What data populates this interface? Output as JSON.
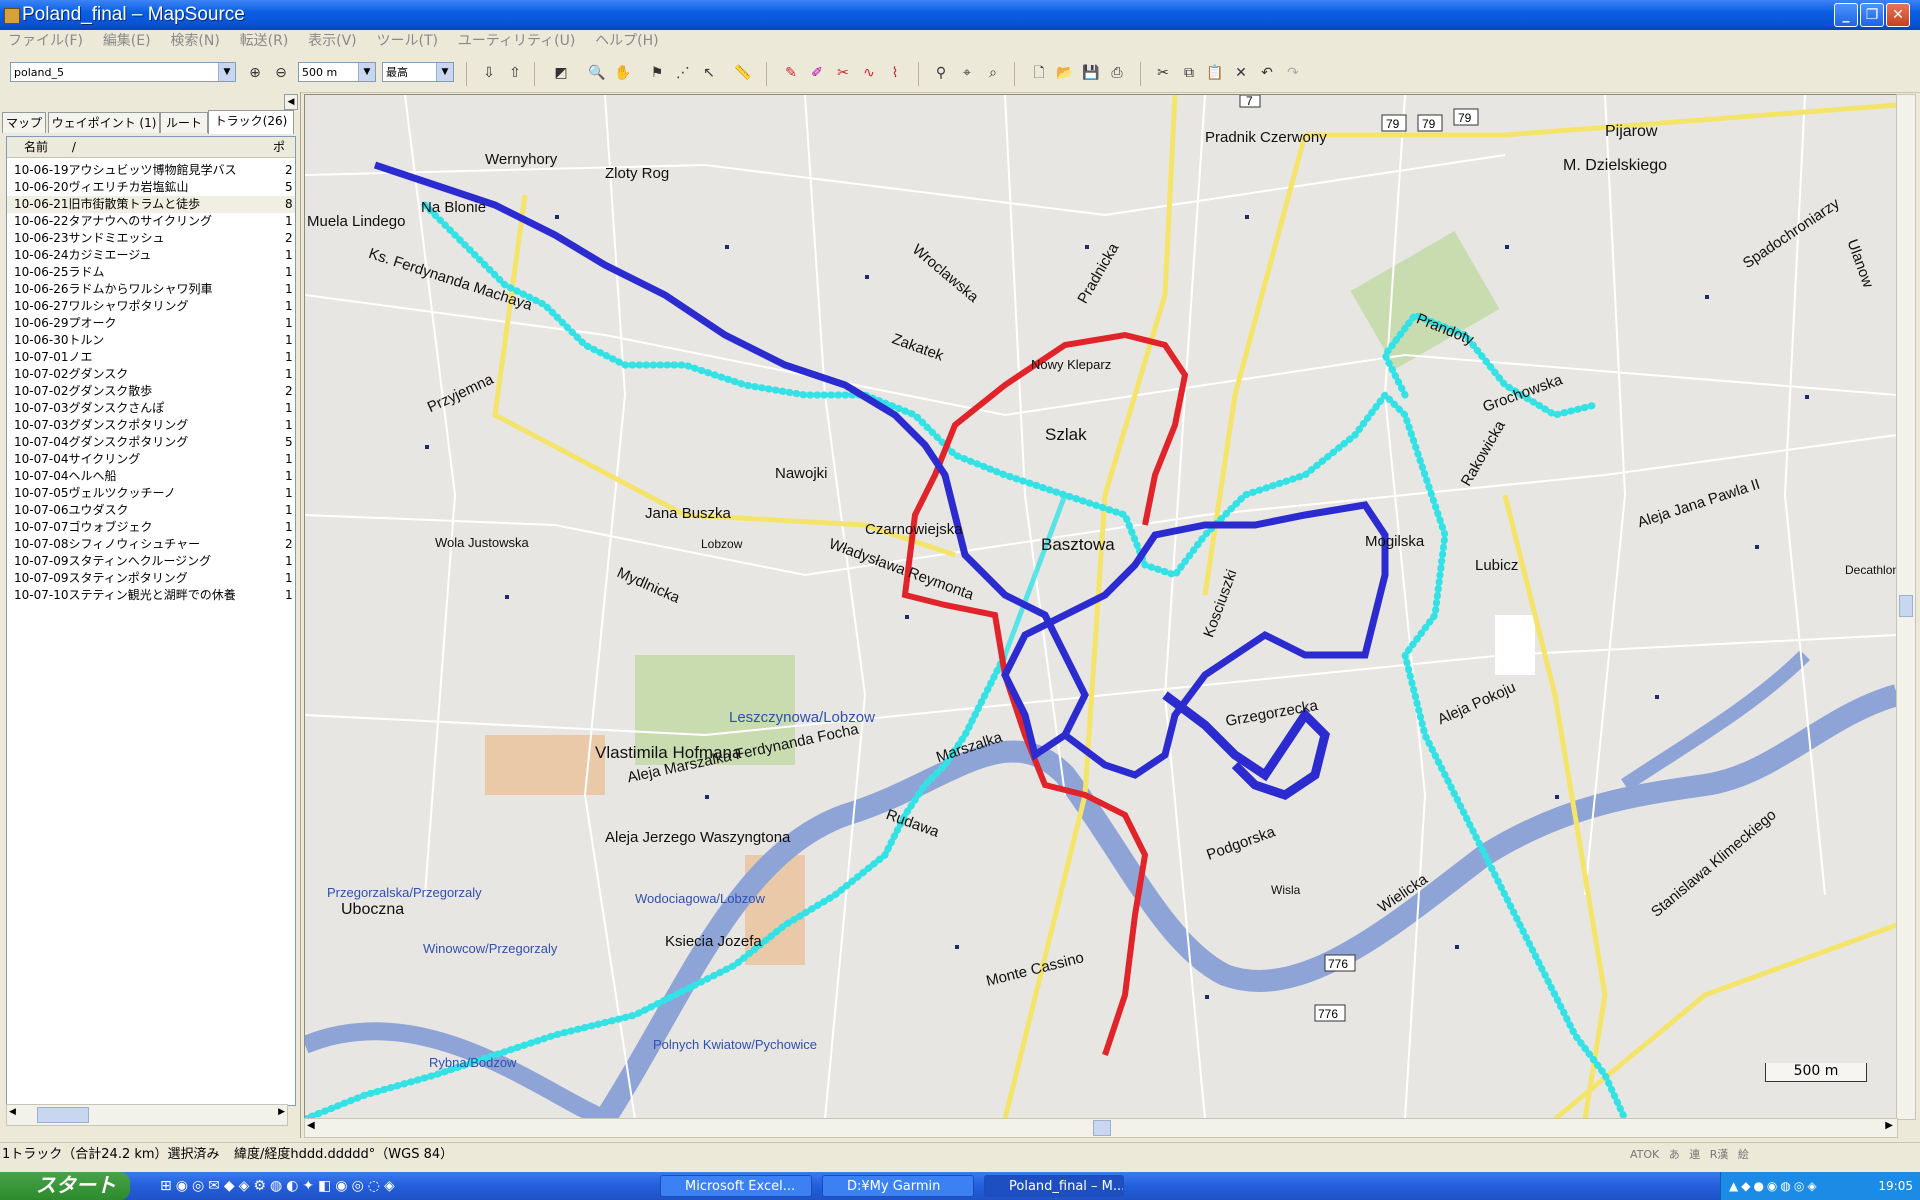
{
  "window": {
    "title": "Poland_final – MapSource",
    "min": "_",
    "max": "❐",
    "close": "✕"
  },
  "menu": [
    "ファイル(F)",
    "編集(E)",
    "検索(N)",
    "転送(R)",
    "表示(V)",
    "ツール(T)",
    "ユーティリティ(U)",
    "ヘルプ(H)"
  ],
  "toolbar": {
    "product": "poland_5",
    "scale": "500 m",
    "detail": "最高"
  },
  "tabs": [
    "マップ",
    "ウェイポイント (1)",
    "ルート",
    "トラック(26)"
  ],
  "list": {
    "col_name": "名前",
    "col_sort": "/",
    "col_pts": "ポ",
    "rows": [
      {
        "name": "10-06-19アウシュビッツ博物館見学バス",
        "v": "2"
      },
      {
        "name": "10-06-20ヴィエリチカ岩塩鉱山",
        "v": "5"
      },
      {
        "name": "10-06-21旧市街散策トラムと徒歩",
        "v": "8"
      },
      {
        "name": "10-06-22タアナウへのサイクリング",
        "v": "1"
      },
      {
        "name": "10-06-23サンドミエッシュ",
        "v": "2"
      },
      {
        "name": "10-06-24カジミエージュ",
        "v": "1"
      },
      {
        "name": "10-06-25ラドム",
        "v": "1"
      },
      {
        "name": "10-06-26ラドムからワルシャワ列車",
        "v": "1"
      },
      {
        "name": "10-06-27ワルシャワポタリング",
        "v": "1"
      },
      {
        "name": "10-06-29プオーク",
        "v": "1"
      },
      {
        "name": "10-06-30トルン",
        "v": "1"
      },
      {
        "name": "10-07-01ノエ",
        "v": "1"
      },
      {
        "name": "10-07-02グダンスク",
        "v": "1"
      },
      {
        "name": "10-07-02グダンスク散歩",
        "v": "2"
      },
      {
        "name": "10-07-03グダンスクさんぽ",
        "v": "1"
      },
      {
        "name": "10-07-03グダンスクポタリング",
        "v": "1"
      },
      {
        "name": "10-07-04グダンスクポタリング",
        "v": "5"
      },
      {
        "name": "10-07-04サイクリング",
        "v": "1"
      },
      {
        "name": "10-07-04ヘルへ船",
        "v": "1"
      },
      {
        "name": "10-07-05ヴェルツクッチーノ",
        "v": "1"
      },
      {
        "name": "10-07-06ユウダスク",
        "v": "1"
      },
      {
        "name": "10-07-07ゴウォブジェク",
        "v": "1"
      },
      {
        "name": "10-07-08シフィノウィシュチャー",
        "v": "2"
      },
      {
        "name": "10-07-09スタティンへクルージング",
        "v": "1"
      },
      {
        "name": "10-07-09スタティンポタリング",
        "v": "1"
      },
      {
        "name": "10-07-10ステティン観光と湖畔での休養",
        "v": "1"
      }
    ]
  },
  "map_labels": [
    "Wernyhory",
    "Zloty Rog",
    "Na Blonie",
    "Muela Lindego",
    "Ks. Ferdynanda Machaya",
    "Przyjemna",
    "Nawojki",
    "Jana Buszka",
    "Czarnowiejska",
    "Władysława Reymonta",
    "Mydlnicka",
    "Wola Justowska",
    "Lobzow",
    "Leszczynowa/Lobzow",
    "Vlastimila Hofmana",
    "Aleja Marszalka Ferdynanda Focha",
    "Aleja Jerzego Waszyngtona",
    "Przegorzalska/Przegorzaly",
    "Uboczna",
    "Winowcow/Przegorzaly",
    "Wodociagowa/Lobzow",
    "Ksiecia Jozefa",
    "Rybna/Bodzow",
    "Polnych Kwiatow/Pychowice",
    "Monte Cassino",
    "Grzegorzecka",
    "Mogilska",
    "Lubicz",
    "Aleja Jana Pawla II",
    "Prandoty",
    "Grochowska",
    "Rakowicka",
    "Pradnik Czerwony",
    "M. Dzielskiego",
    "Pijarow",
    "Nowy Kleparz",
    "Szlak",
    "Basztowa",
    "Zakatek",
    "Wroclawska",
    "Pradnicka",
    "Aleja Pokoju",
    "Podgorska",
    "Stanislawa Klimeckiego",
    "Wielicka",
    "Wisla",
    "Spadochroniarzy",
    "Ulanow",
    "Decathlon",
    "Rudawa",
    "Marszalka",
    "Kosciuszki"
  ],
  "shields": [
    "79",
    "79",
    "79",
    "7",
    "79",
    "776",
    "776"
  ],
  "scale_label": "500 m",
  "status": {
    "left": "1トラック（合計24.2 km）選択済み",
    "coord": "緯度/経度hddd.ddddd°（WGS 84）"
  },
  "ime": [
    "ATOK",
    "あ",
    "連",
    "R漢",
    "絵"
  ],
  "taskbar": {
    "start": "スタート",
    "items": [
      "Microsoft Excel...",
      "D:¥My Garmin",
      "Poland_final – M..."
    ],
    "clock": "19:05"
  },
  "colors": {
    "track_blue": "#2b2bd0",
    "track_cyan": "#34e2e6",
    "track_red": "#e0242a",
    "river": "#8ea4d6",
    "major_road": "#f4e46a"
  }
}
